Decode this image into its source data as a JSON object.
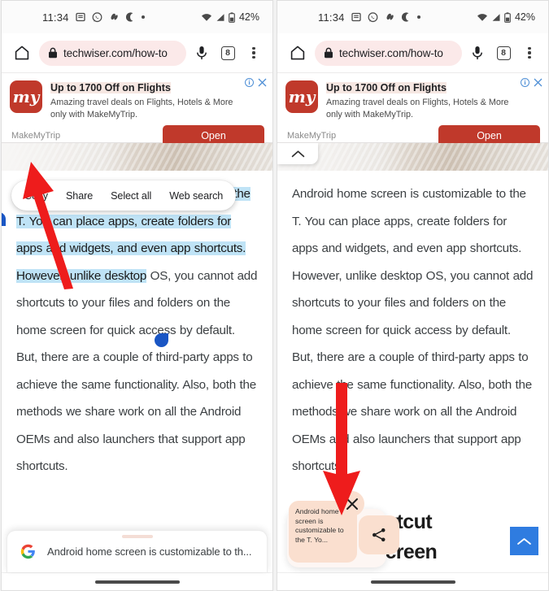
{
  "statusbar": {
    "time": "11:34",
    "icons": [
      "document-icon",
      "whatsapp-icon",
      "pinterest-icon",
      "crescent-moon-icon",
      "dot-icon"
    ],
    "right_icons": [
      "wifi-icon",
      "signal-icon",
      "battery-icon"
    ],
    "battery": "42%"
  },
  "omnibox": {
    "home_icon": "home-icon",
    "lock_icon": "lock-icon",
    "url": "techwiser.com/how-to",
    "mic_icon": "microphone-icon",
    "tab_count": "8",
    "menu_icon": "kebab-menu-icon"
  },
  "ad": {
    "logo_text": "my",
    "title": "Up to 1700 Off on Flights",
    "description": "Amazing travel deals on Flights, Hotels & More only with MakeMyTrip.",
    "advertiser": "MakeMyTrip",
    "cta": "Open",
    "info_icon": "ad-choices-icon",
    "close_icon": "close-icon"
  },
  "context_menu": {
    "items": [
      {
        "label": "Copy",
        "name": "copy"
      },
      {
        "label": "Share",
        "name": "share"
      },
      {
        "label": "Select all",
        "name": "select-all"
      },
      {
        "label": "Web search",
        "name": "web-search"
      }
    ]
  },
  "article": {
    "selected_part": "Android home screen is customizable to the T. You can place apps, create folders for apps and widgets, and even app shortcuts. However, unlike desktop",
    "unselected_part": " OS, you cannot add shortcuts to your files and folders on the home screen for quick access by default. But, there are a couple of third-party apps to achieve the same functionality. Also, both the methods we share work on all the Android OEMs and also launchers that support app shortcuts.",
    "full_text": "Android home screen is customizable to the T. You can place apps, create folders for apps and widgets, and even app shortcuts. However, unlike desktop OS, you cannot add shortcuts to your files and folders on the home screen for quick access by default. But, there are a couple of third-party apps to achieve the same functionality. Also, both the methods we share work on all the Android OEMs and also launchers that support app shortcuts."
  },
  "left_panel": {
    "google_bar": {
      "logo": "google-g-icon",
      "query": "Android home screen is customizable to th..."
    },
    "nav_pill": "home-gesture-pill"
  },
  "right_panel": {
    "collapse_icon": "chevron-up-icon",
    "heading_line1": "olden Shortcut",
    "heading_line2": "u Home Screen",
    "clipboard_chip": {
      "text": "Android home screen is customizable to the T. Yo...",
      "close_icon": "close-icon"
    },
    "share_icon": "share-icon",
    "scroll_top_icon": "chevron-up-icon",
    "nav_pill": "home-gesture-pill"
  },
  "annotations": {
    "arrow_color": "#ee1c1c",
    "left_arrow_target": "Copy",
    "right_arrow_target": "clipboard-chip"
  },
  "colors": {
    "selection_highlight": "#bfe3f6",
    "selection_handle": "#1a56c4",
    "ad_accent": "#c0392b",
    "url_pill": "#fbe9e9",
    "chip_peach": "#fadfcf",
    "scroll_top_blue": "#2f7ce0"
  }
}
